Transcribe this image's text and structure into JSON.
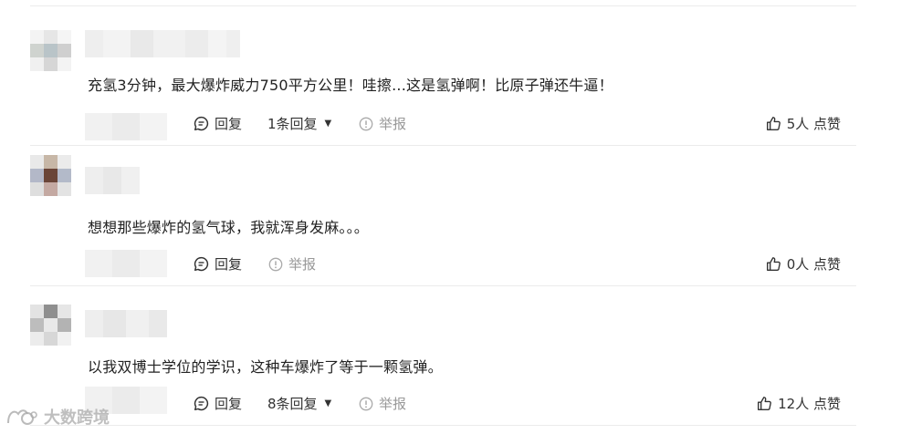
{
  "comments": [
    {
      "text": "充氢3分钟，最大爆炸威力750平方公里！哇擦...这是氢弹啊！比原子弹还牛逼！",
      "reply_label": "回复",
      "replies_label": "1条回复",
      "report_label": "举报",
      "like_label": "5人 点赞"
    },
    {
      "text": "想想那些爆炸的氢气球，我就浑身发麻。。。",
      "reply_label": "回复",
      "report_label": "举报",
      "like_label": "0人 点赞"
    },
    {
      "text": "以我双博士学位的学识，这种车爆炸了等于一颗氢弹。",
      "reply_label": "回复",
      "replies_label": "8条回复",
      "report_label": "举报",
      "like_label": "12人 点赞"
    }
  ],
  "watermark": {
    "text": "大数跨境"
  },
  "icons": {
    "reply": "chat-bubble-icon",
    "report": "warning-circle-icon",
    "like": "thumbs-up-icon",
    "dropdown": "caret-down-icon"
  },
  "colors": {
    "text": "#222222",
    "muted": "#999999",
    "divider": "#ebebeb"
  }
}
